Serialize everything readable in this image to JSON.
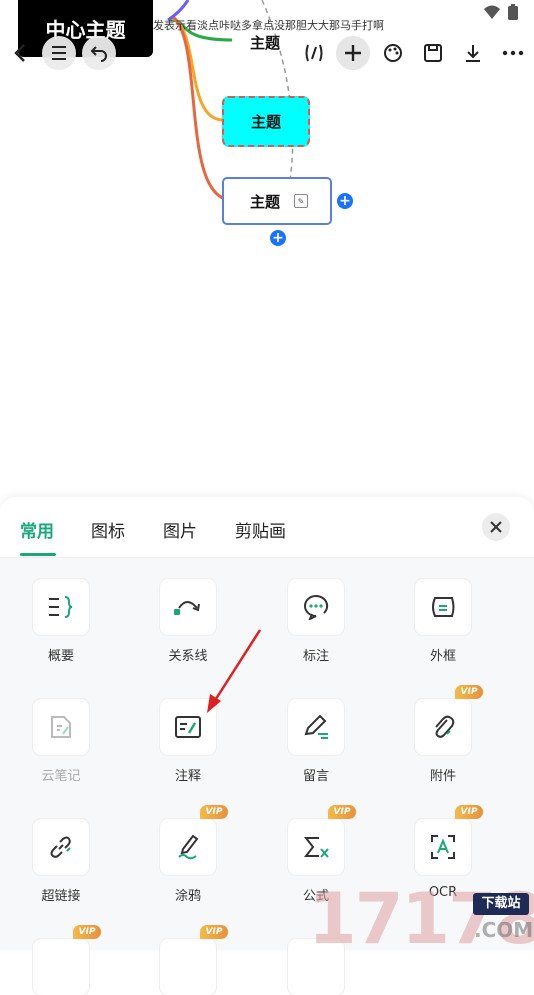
{
  "mindmap": {
    "central_topic": "中心主题",
    "note_text": "发表示看淡点咔哒多拿点没那胆大大那马手打啊",
    "topics": [
      "主题",
      "主题",
      "主题"
    ]
  },
  "toolbar": {
    "icons": [
      "back-icon",
      "outline-icon",
      "undo-icon",
      "format-icon",
      "add-icon",
      "palette-icon",
      "save-icon",
      "download-icon",
      "more-icon"
    ]
  },
  "panel": {
    "tabs": [
      "常用",
      "图标",
      "图片",
      "剪贴画"
    ],
    "tools": [
      {
        "label": "概要",
        "vip": false
      },
      {
        "label": "关系线",
        "vip": false
      },
      {
        "label": "标注",
        "vip": false
      },
      {
        "label": "外框",
        "vip": false
      },
      {
        "label": "云笔记",
        "vip": false
      },
      {
        "label": "注释",
        "vip": false
      },
      {
        "label": "留言",
        "vip": false
      },
      {
        "label": "附件",
        "vip": true
      },
      {
        "label": "超链接",
        "vip": false
      },
      {
        "label": "涂鸦",
        "vip": true
      },
      {
        "label": "公式",
        "vip": true
      },
      {
        "label": "OCR",
        "vip": true
      }
    ],
    "vip_text": "VIP"
  },
  "watermark": {
    "number": "17178",
    "badge": "下载站",
    "suffix": ".COM"
  },
  "colors": {
    "accent": "#1aa87b",
    "central_bg": "#000000",
    "topic_fill": "#00ffff",
    "topic_dash": "#e0574f",
    "selected_border": "#5b7fe0",
    "add_button": "#1a73ff"
  }
}
